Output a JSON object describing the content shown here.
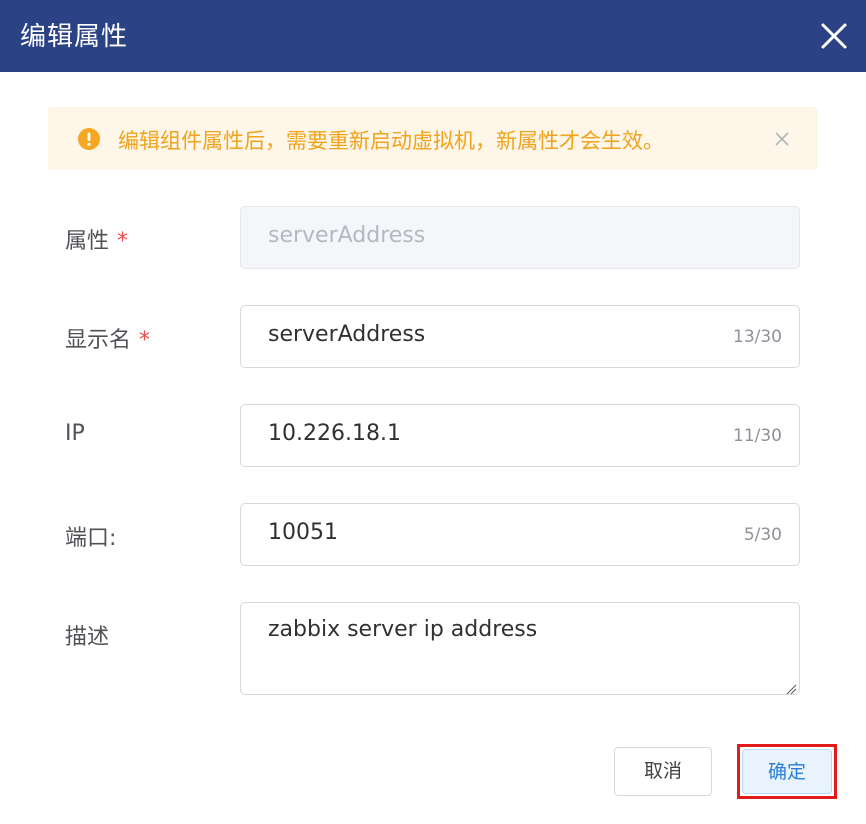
{
  "dialog": {
    "title": "编辑属性",
    "close_icon": "close-icon"
  },
  "alert": {
    "icon": "warning-icon",
    "text": "编辑组件属性后，需要重新启动虚拟机，新属性才会生效。",
    "close_icon": "close-icon",
    "color": "#f0a31b",
    "background": "#fdf6e9"
  },
  "form": {
    "property": {
      "label": "属性",
      "required_mark": "*",
      "value": "serverAddress",
      "disabled": true
    },
    "display_name": {
      "label": "显示名",
      "required_mark": "*",
      "value": "serverAddress",
      "count": "13/30"
    },
    "ip": {
      "label": "IP",
      "value": "10.226.18.1",
      "count": "11/30"
    },
    "port": {
      "label": "端口:",
      "value": "10051",
      "count": "5/30"
    },
    "description": {
      "label": "描述",
      "value": "zabbix server ip address"
    }
  },
  "footer": {
    "cancel_label": "取消",
    "ok_label": "确定"
  },
  "colors": {
    "header": "#2b4284",
    "required": "#f04a4a",
    "highlight_border": "#e21a1a",
    "primary_text": "#2a7fd4"
  }
}
